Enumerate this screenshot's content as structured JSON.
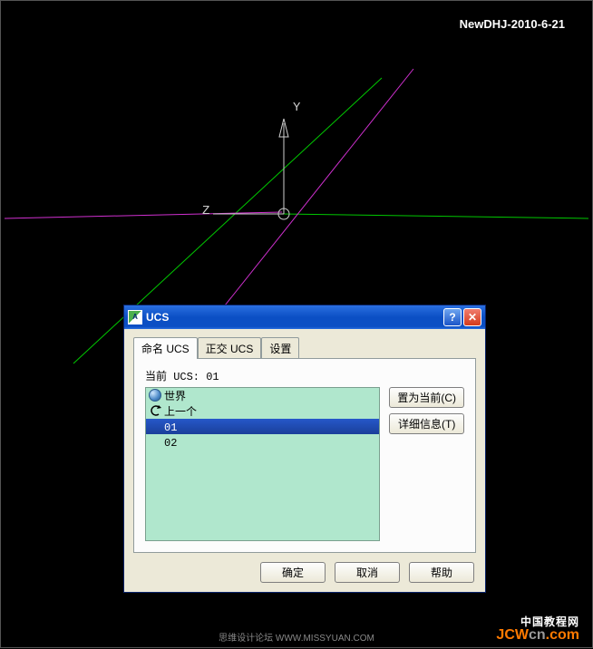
{
  "watermark_top": "NewDHJ-2010-6-21",
  "axes": {
    "y": "Y",
    "z": "Z"
  },
  "dialog": {
    "title": "UCS",
    "tabs": [
      {
        "label": "命名 UCS",
        "active": true
      },
      {
        "label": "正交 UCS",
        "active": false
      },
      {
        "label": "设置",
        "active": false
      }
    ],
    "current_label": "当前 UCS:  01",
    "list": [
      {
        "icon": "globe",
        "label": "世界"
      },
      {
        "icon": "arrow",
        "label": "上一个"
      },
      {
        "icon": "",
        "label": "01",
        "selected": true
      },
      {
        "icon": "",
        "label": "02"
      }
    ],
    "side_buttons": {
      "set_current": "置为当前(C)",
      "details": "详细信息(T)"
    },
    "bottom_buttons": {
      "ok": "确定",
      "cancel": "取消",
      "help": "帮助"
    }
  },
  "watermark_bottom": "思维设计论坛  WWW.MISSYUAN.COM",
  "watermark_site_cn": "中国教程网",
  "watermark_site_url_a": "JCW",
  "watermark_site_url_b": "cn",
  "watermark_site_url_c": ".com"
}
